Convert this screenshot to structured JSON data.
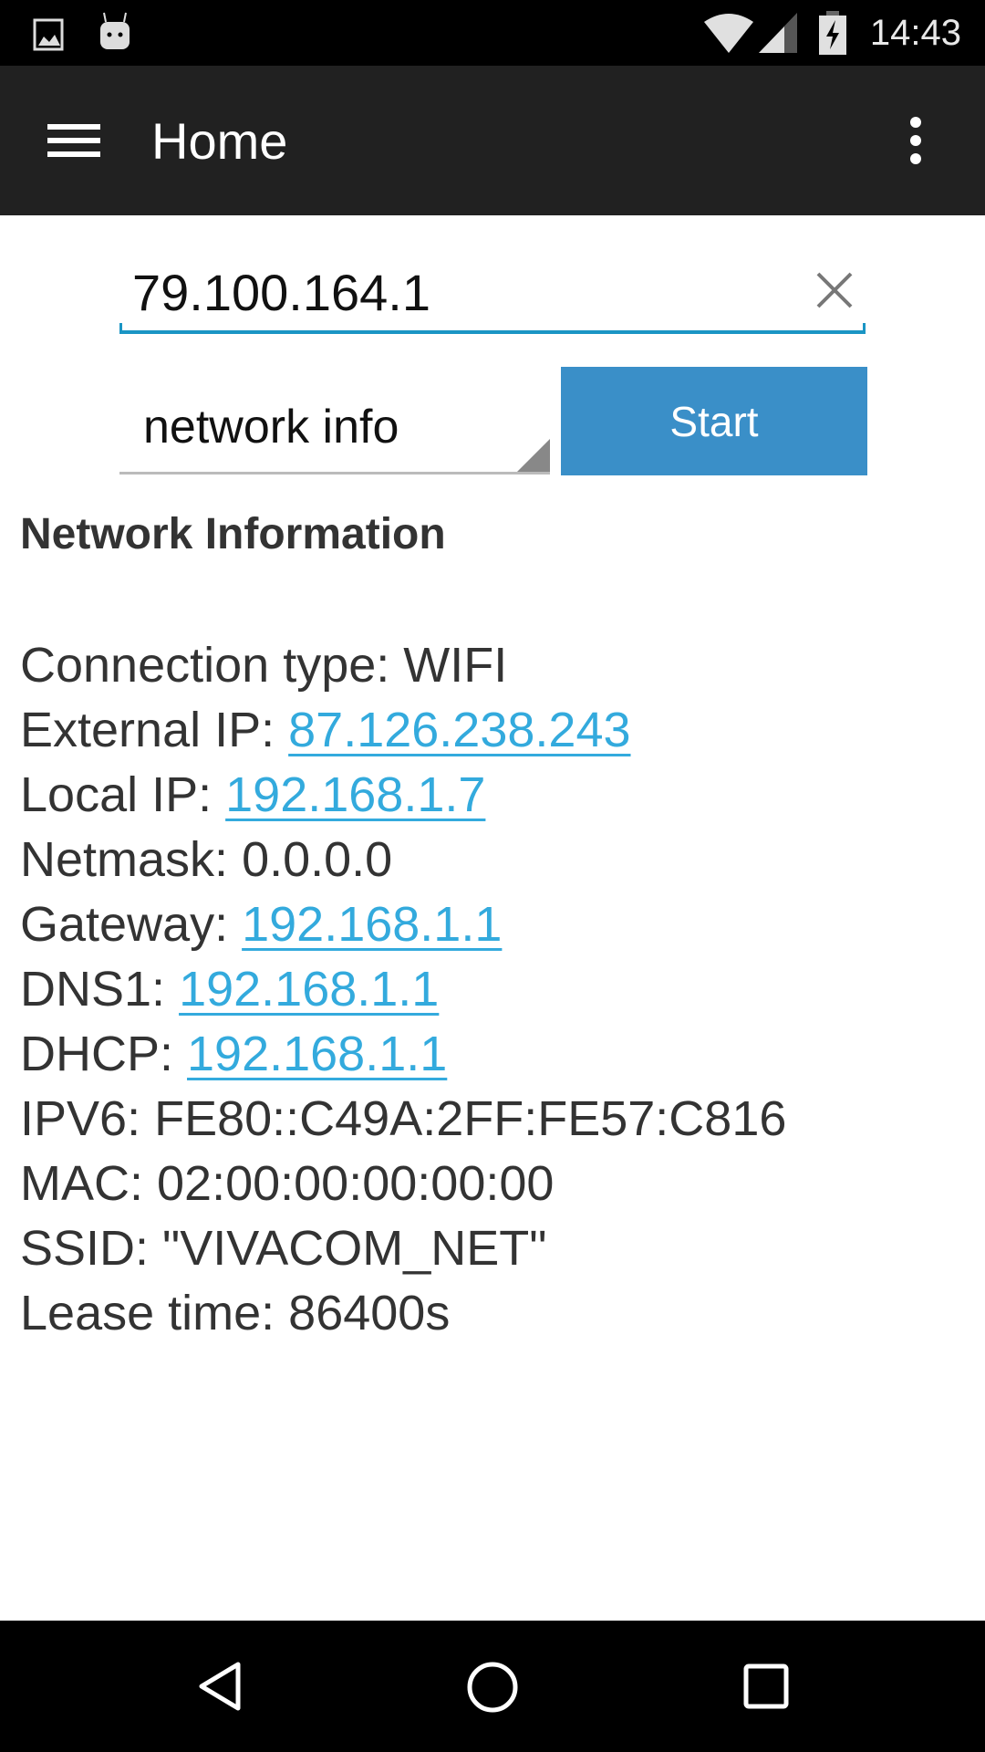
{
  "status_bar": {
    "time": "14:43",
    "icons": [
      "image-notification-icon",
      "android-notification-icon",
      "wifi-icon",
      "cell-signal-icon",
      "battery-charging-icon"
    ]
  },
  "app_bar": {
    "title": "Home",
    "menu_icon": "hamburger-icon",
    "overflow_icon": "more-vert-icon"
  },
  "host_input": {
    "value": "79.100.164.1",
    "clear_icon": "close-icon"
  },
  "tool_select": {
    "value": "network info"
  },
  "start_button": {
    "label": "Start"
  },
  "result": {
    "heading": "Network Information",
    "lines": [
      {
        "label": "Connection type: ",
        "value": "WIFI",
        "link": false
      },
      {
        "label": "External IP: ",
        "value": "87.126.238.243",
        "link": true
      },
      {
        "label": "Local IP: ",
        "value": "192.168.1.7",
        "link": true
      },
      {
        "label": "Netmask: ",
        "value": "0.0.0.0",
        "link": false
      },
      {
        "label": "Gateway: ",
        "value": "192.168.1.1",
        "link": true
      },
      {
        "label": "DNS1: ",
        "value": "192.168.1.1",
        "link": true
      },
      {
        "label": "DHCP: ",
        "value": "192.168.1.1",
        "link": true
      },
      {
        "label": "IPV6: ",
        "value": "FE80::C49A:2FF:FE57:C816",
        "link": false
      },
      {
        "label": "MAC: ",
        "value": "02:00:00:00:00:00",
        "link": false
      },
      {
        "label": "SSID: ",
        "value": "\"VIVACOM_NET\"",
        "link": false
      },
      {
        "label": "Lease time: ",
        "value": "86400s",
        "link": false
      }
    ]
  },
  "colors": {
    "accent": "#1a95c4",
    "button": "#3a8fc8",
    "link": "#33aadd",
    "appbar": "#212121"
  },
  "nav_bar": {
    "icons": [
      "back-icon",
      "home-icon",
      "recents-icon"
    ]
  }
}
